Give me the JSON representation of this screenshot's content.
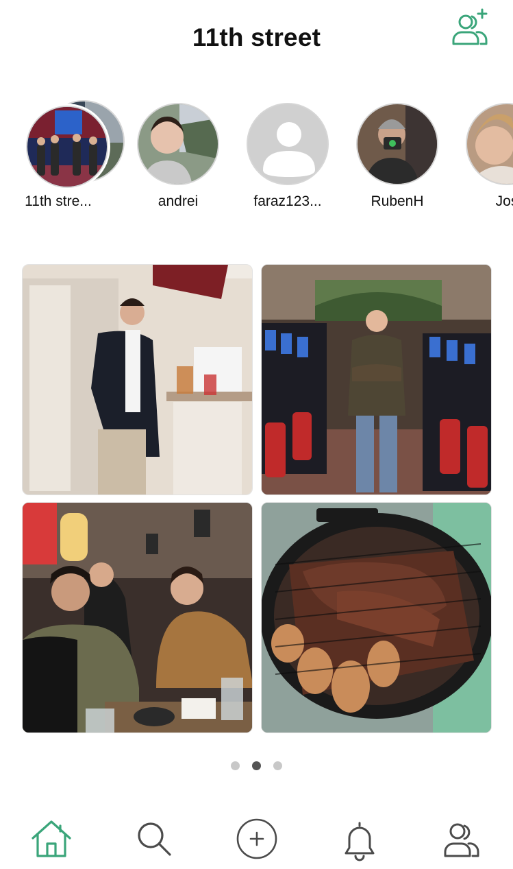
{
  "header": {
    "title": "11th street"
  },
  "stories": [
    {
      "label": "11th stre..."
    },
    {
      "label": "andrei"
    },
    {
      "label": "faraz123..."
    },
    {
      "label": "RubenH"
    },
    {
      "label": "Jos"
    }
  ],
  "pager": {
    "total": 3,
    "active": 2
  },
  "colors": {
    "accent": "#3aa57a",
    "icon": "#4b4b4b",
    "placeholder_avatar": "#d0d0d0"
  },
  "icons": {
    "add_friend": "add-friend-icon",
    "home": "home-icon",
    "search": "search-icon",
    "create": "plus-circle-icon",
    "notifications": "bell-icon",
    "friends": "friends-icon"
  }
}
